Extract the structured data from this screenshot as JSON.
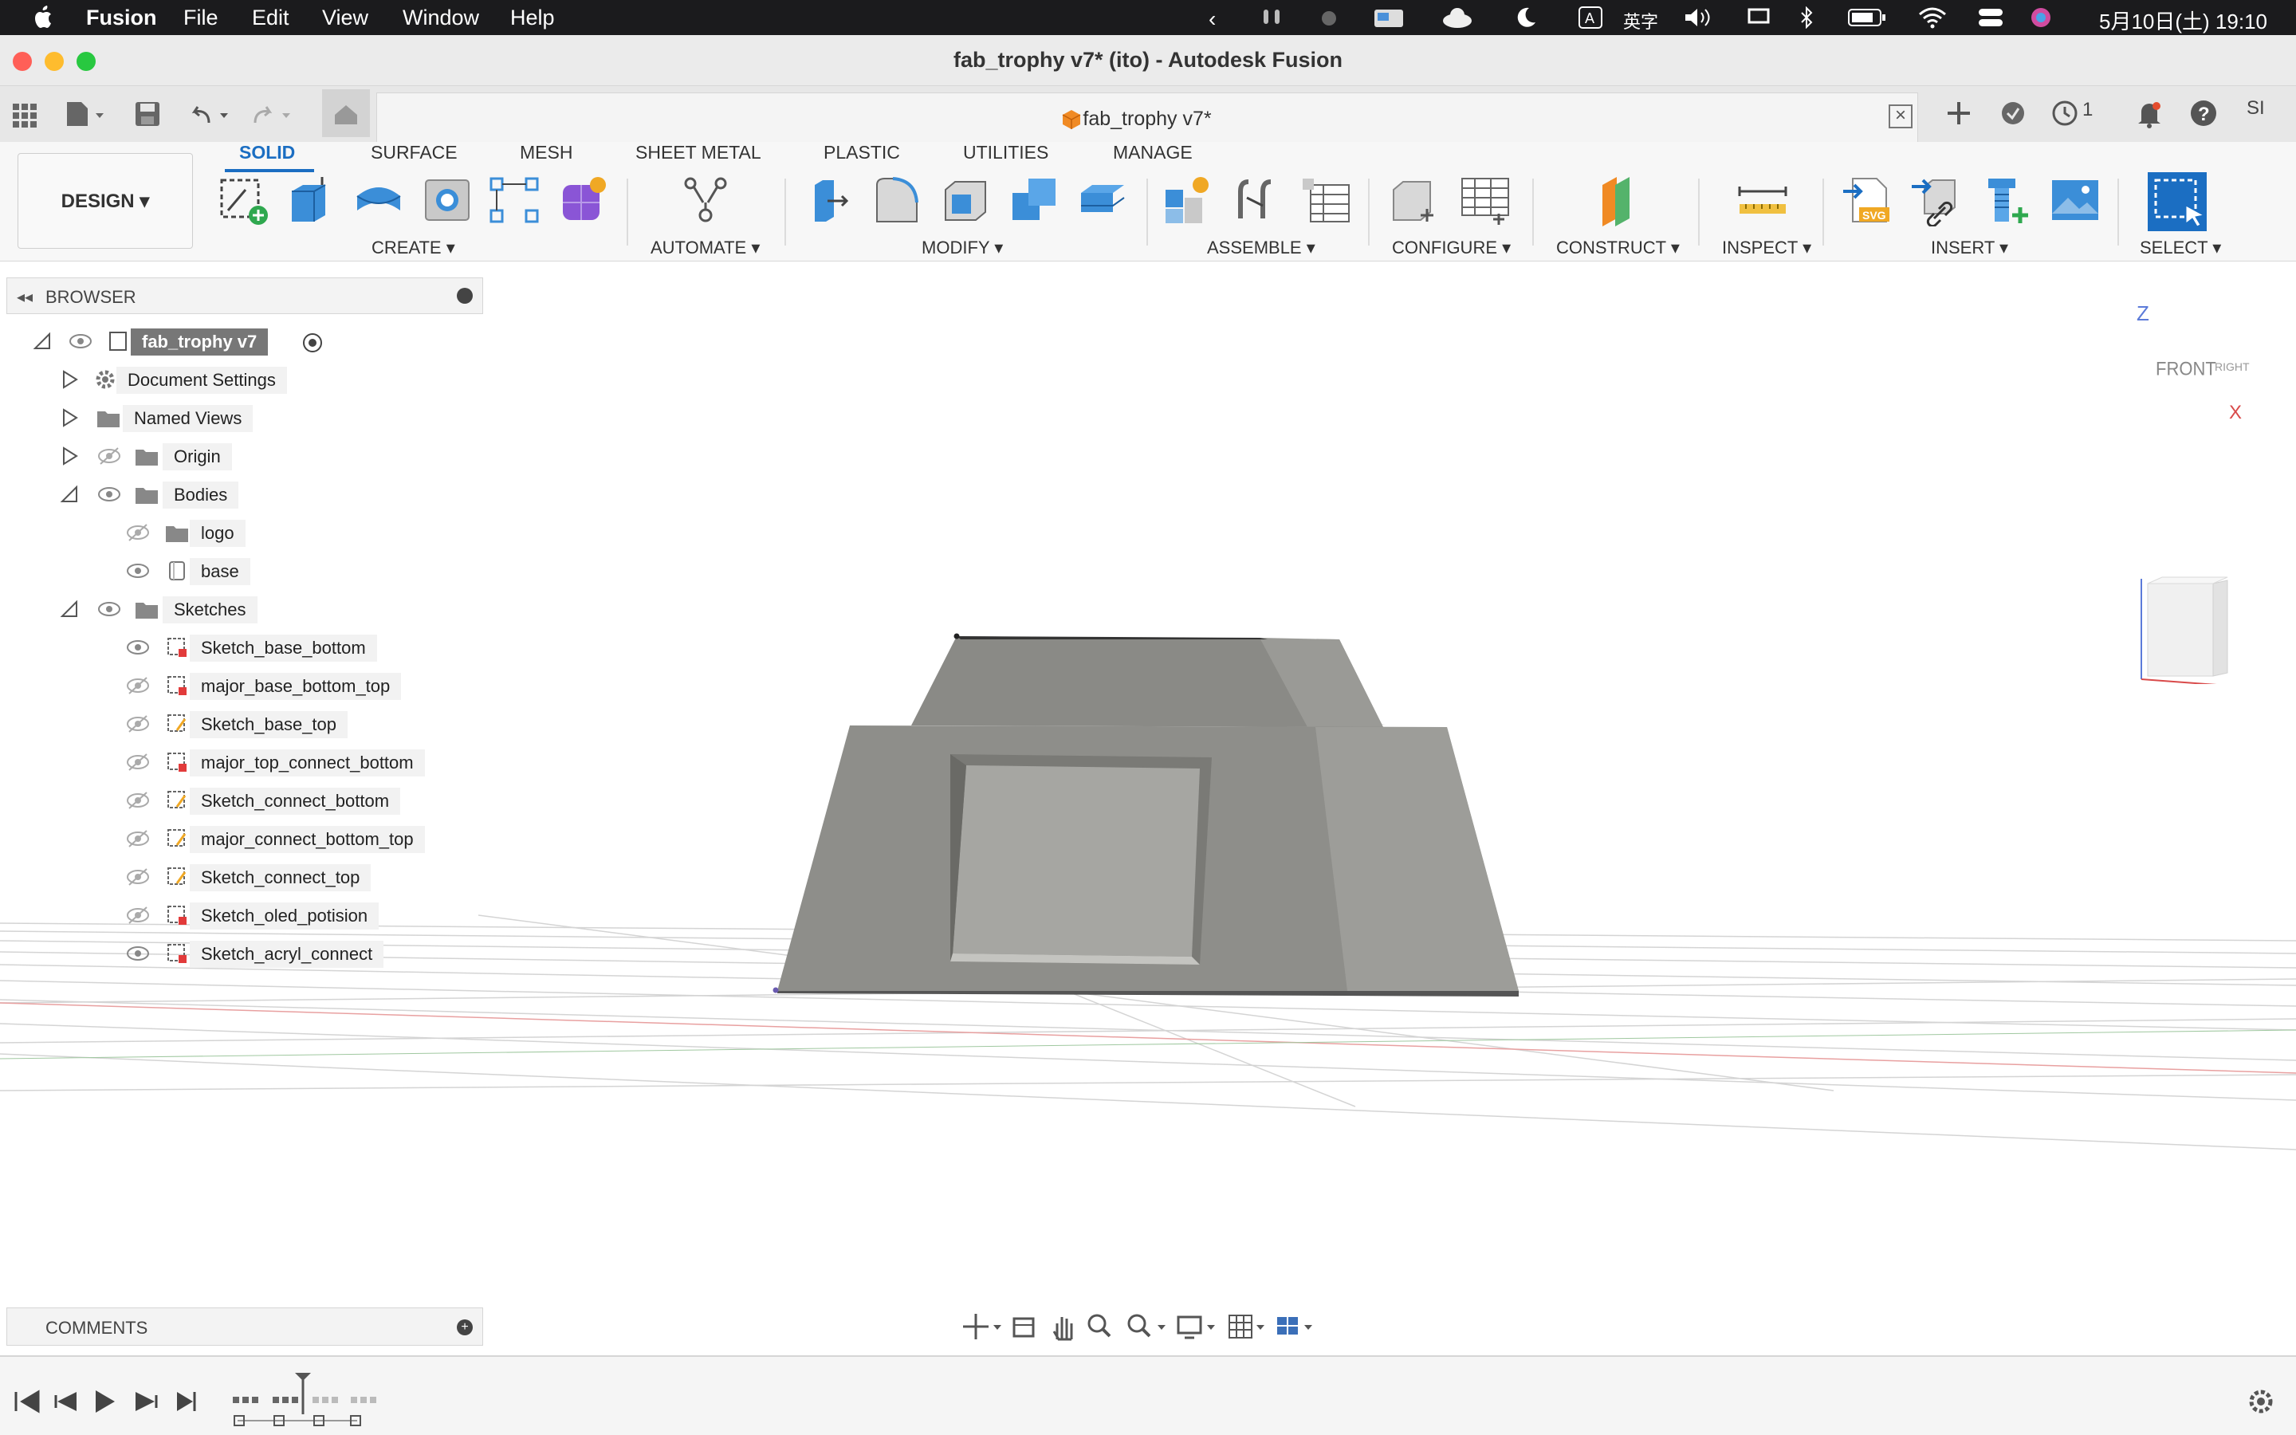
{
  "menubar": {
    "app_name": "Fusion",
    "items": [
      "File",
      "Edit",
      "View",
      "Window",
      "Help"
    ],
    "input_mode": "英字",
    "clock": "5月10日(土) 19:10"
  },
  "window": {
    "title": "fab_trophy v7* (ito) - Autodesk Fusion"
  },
  "document_tab": {
    "title": "fab_trophy v7*",
    "job_count": "1",
    "user_initials": "SI"
  },
  "ribbon": {
    "workspace": "DESIGN",
    "tabs": [
      "SOLID",
      "SURFACE",
      "MESH",
      "SHEET METAL",
      "PLASTIC",
      "UTILITIES",
      "MANAGE"
    ],
    "active_tab": "SOLID",
    "groups": [
      "CREATE",
      "AUTOMATE",
      "MODIFY",
      "ASSEMBLE",
      "CONFIGURE",
      "CONSTRUCT",
      "INSPECT",
      "INSERT",
      "SELECT"
    ]
  },
  "browser": {
    "title": "BROWSER",
    "root": "fab_trophy v7",
    "document_settings": "Document Settings",
    "named_views": "Named Views",
    "origin": "Origin",
    "bodies": {
      "label": "Bodies",
      "items": [
        "logo",
        "base"
      ]
    },
    "sketches": {
      "label": "Sketches",
      "items": [
        "Sketch_base_bottom",
        "major_base_bottom_top",
        "Sketch_base_top",
        "major_top_connect_bottom",
        "Sketch_connect_bottom",
        "major_connect_bottom_top",
        "Sketch_connect_top",
        "Sketch_oled_potision",
        "Sketch_acryl_connect"
      ]
    }
  },
  "viewcube": {
    "front": "FRONT",
    "right": "RIGHT",
    "z_axis": "Z",
    "x_axis": "X"
  },
  "comments": {
    "title": "COMMENTS"
  },
  "colors": {
    "accent": "#1b6ec2",
    "model_gray": "#8e8e8a",
    "menubar_bg": "#1b1b1d"
  }
}
